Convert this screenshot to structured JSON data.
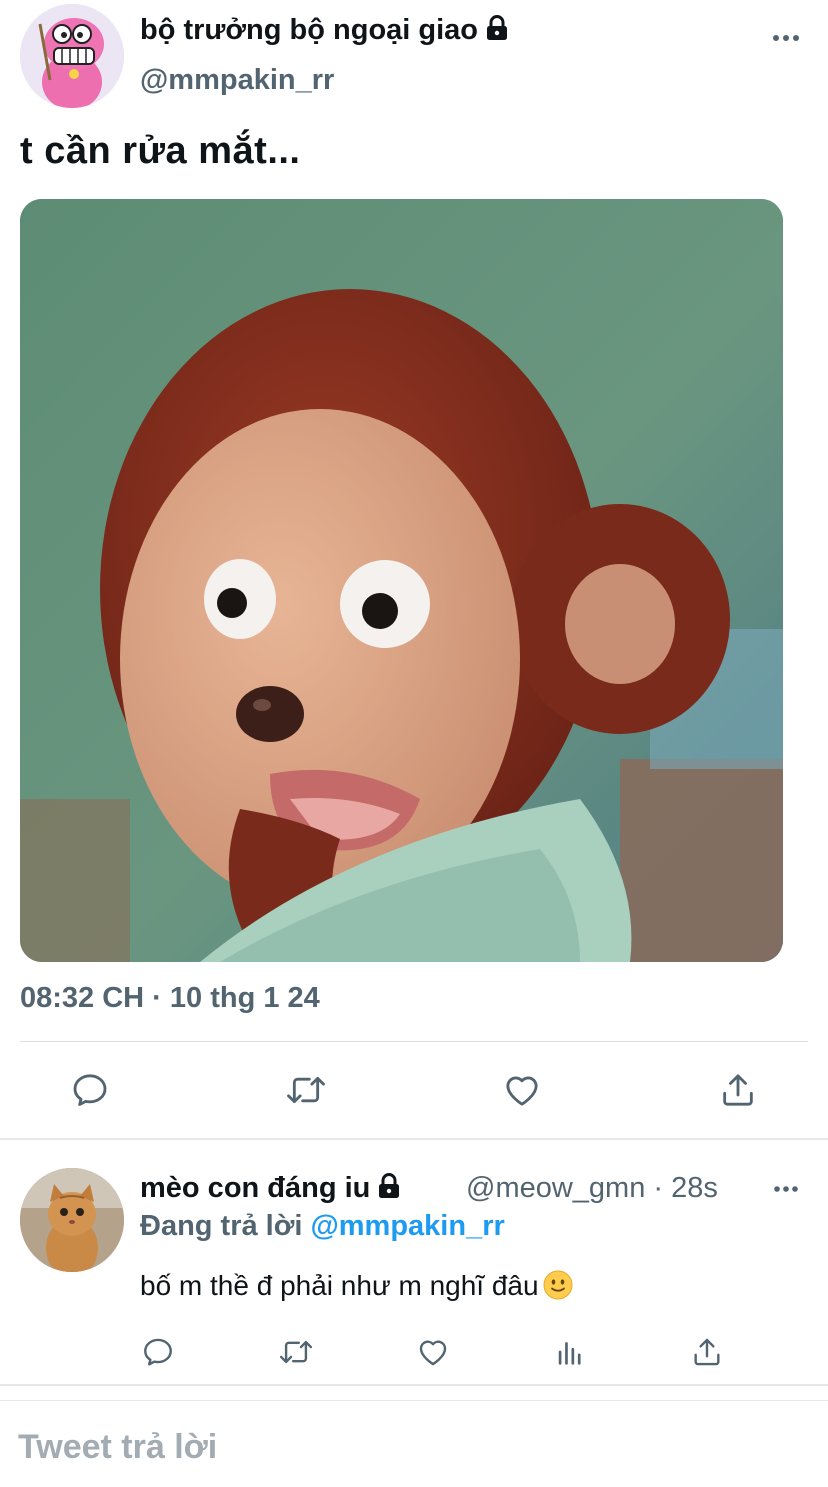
{
  "tweet": {
    "author": {
      "display_name": "bộ trưởng bộ ngoại giao",
      "handle": "@mmpakin_rr",
      "protected_icon": "lock-icon"
    },
    "text": "t cần rửa mắt...",
    "timestamp": "08:32 CH · 10 thg 1 24",
    "actions": [
      "reply-icon",
      "retweet-icon",
      "like-icon",
      "share-icon"
    ]
  },
  "reply": {
    "author": {
      "display_name": "mèo con đáng iu",
      "handle_time": "@meow_gmn · 28s",
      "protected_icon": "lock-icon"
    },
    "replying_prefix": "Đang trả lời",
    "replying_to": "@mmpakin_rr",
    "text": "bố m thề đ phải như m nghĩ đâu",
    "emoji": "slightly-smiling-face",
    "actions": [
      "reply-icon",
      "retweet-icon",
      "like-icon",
      "analytics-icon",
      "share-icon"
    ]
  },
  "compose": {
    "placeholder": "Tweet trả lời"
  },
  "colors": {
    "text": "#0f1419",
    "secondary": "#536471",
    "link": "#1d9bf0",
    "divider": "#e4e8eb"
  }
}
